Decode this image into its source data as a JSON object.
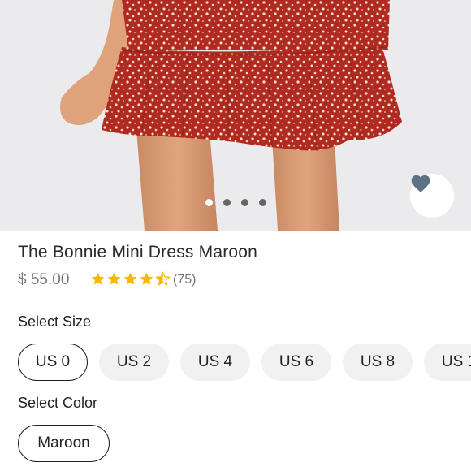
{
  "product": {
    "title": "The Bonnie Mini Dress Maroon",
    "price": "$ 55.00",
    "rating": 4.5,
    "rating_max": 5,
    "review_count": "(75)"
  },
  "gallery": {
    "image_count": 4,
    "active_index": 0
  },
  "size": {
    "label": "Select Size",
    "options": [
      "US 0",
      "US 2",
      "US 4",
      "US 6",
      "US 8",
      "US 1"
    ],
    "selected": "US 0"
  },
  "color": {
    "label": "Select Color",
    "options": [
      "Maroon"
    ],
    "selected": "Maroon"
  },
  "icons": {
    "favorite": "heart-icon",
    "rating": "star-icon"
  },
  "colors": {
    "dress": "#b4281f",
    "star": "#f5b800",
    "heart": "#5e7286"
  }
}
